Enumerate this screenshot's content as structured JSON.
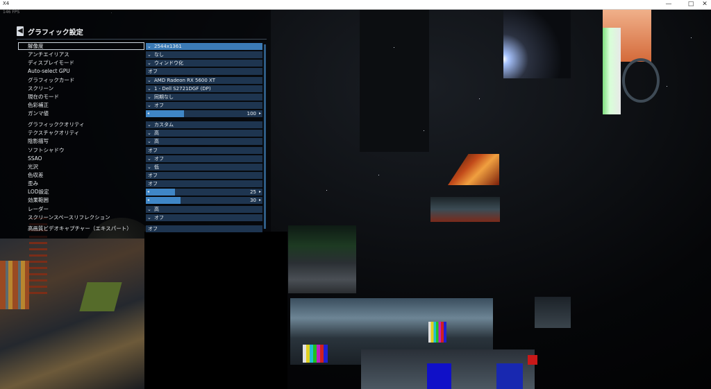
{
  "window": {
    "title": "X4",
    "fps": "146 FPS"
  },
  "menu": {
    "title": "グラフィック設定",
    "rows": [
      {
        "label": "解像度",
        "value": "2544x1361",
        "kind": "dropdown",
        "selected": true
      },
      {
        "label": "アンチエイリアス",
        "value": "なし",
        "kind": "dropdown"
      },
      {
        "label": "ディスプレイモード",
        "value": "ウィンドウ化",
        "kind": "dropdown"
      },
      {
        "label": "Auto-select GPU",
        "value": "オフ",
        "kind": "plain"
      },
      {
        "label": "グラフィックカード",
        "value": "AMD Radeon RX 5600 XT",
        "kind": "dropdown"
      },
      {
        "label": "スクリーン",
        "value": "1 - Dell S2721DGF (DP)",
        "kind": "dropdown"
      },
      {
        "label": "現在のモード",
        "value": "同期なし",
        "kind": "dropdown"
      },
      {
        "label": "色彩補正",
        "value": "オフ",
        "kind": "dropdown"
      },
      {
        "label": "ガンマ値",
        "value": "100",
        "kind": "slider",
        "fraction": 0.33
      },
      {
        "label": "グラフィッククオリティ",
        "value": "カスタム",
        "kind": "dropdown",
        "gap": true
      },
      {
        "label": "テクスチャクオリティ",
        "value": "高",
        "kind": "dropdown"
      },
      {
        "label": "陰影描写",
        "value": "高",
        "kind": "dropdown"
      },
      {
        "label": "ソフトシャドウ",
        "value": "オフ",
        "kind": "plain"
      },
      {
        "label": "SSAO",
        "value": "オフ",
        "kind": "dropdown"
      },
      {
        "label": "光沢",
        "value": "低",
        "kind": "dropdown"
      },
      {
        "label": "色収差",
        "value": "オフ",
        "kind": "plain"
      },
      {
        "label": "歪み",
        "value": "オフ",
        "kind": "plain"
      },
      {
        "label": "LOD設定",
        "value": "25",
        "kind": "slider",
        "fraction": 0.25
      },
      {
        "label": "効果範囲",
        "value": "30",
        "kind": "slider",
        "fraction": 0.3
      },
      {
        "label": "レーダー",
        "value": "高",
        "kind": "dropdown"
      },
      {
        "label": "スクリーンスペースリフレクション",
        "value": "オフ",
        "kind": "dropdown"
      },
      {
        "label": "高画質ビデオキャプチャー（エキスパート）",
        "value": "オフ",
        "kind": "plain",
        "gap": true
      }
    ]
  },
  "colors": {
    "accent": "#3c7bb6",
    "control_bg": "#1e3550",
    "text": "#e8ecef"
  },
  "icons": {
    "back": "chevron-left-icon",
    "dropdown": "check-chevron-icon",
    "slider_arrow": "triangle-right-icon"
  }
}
